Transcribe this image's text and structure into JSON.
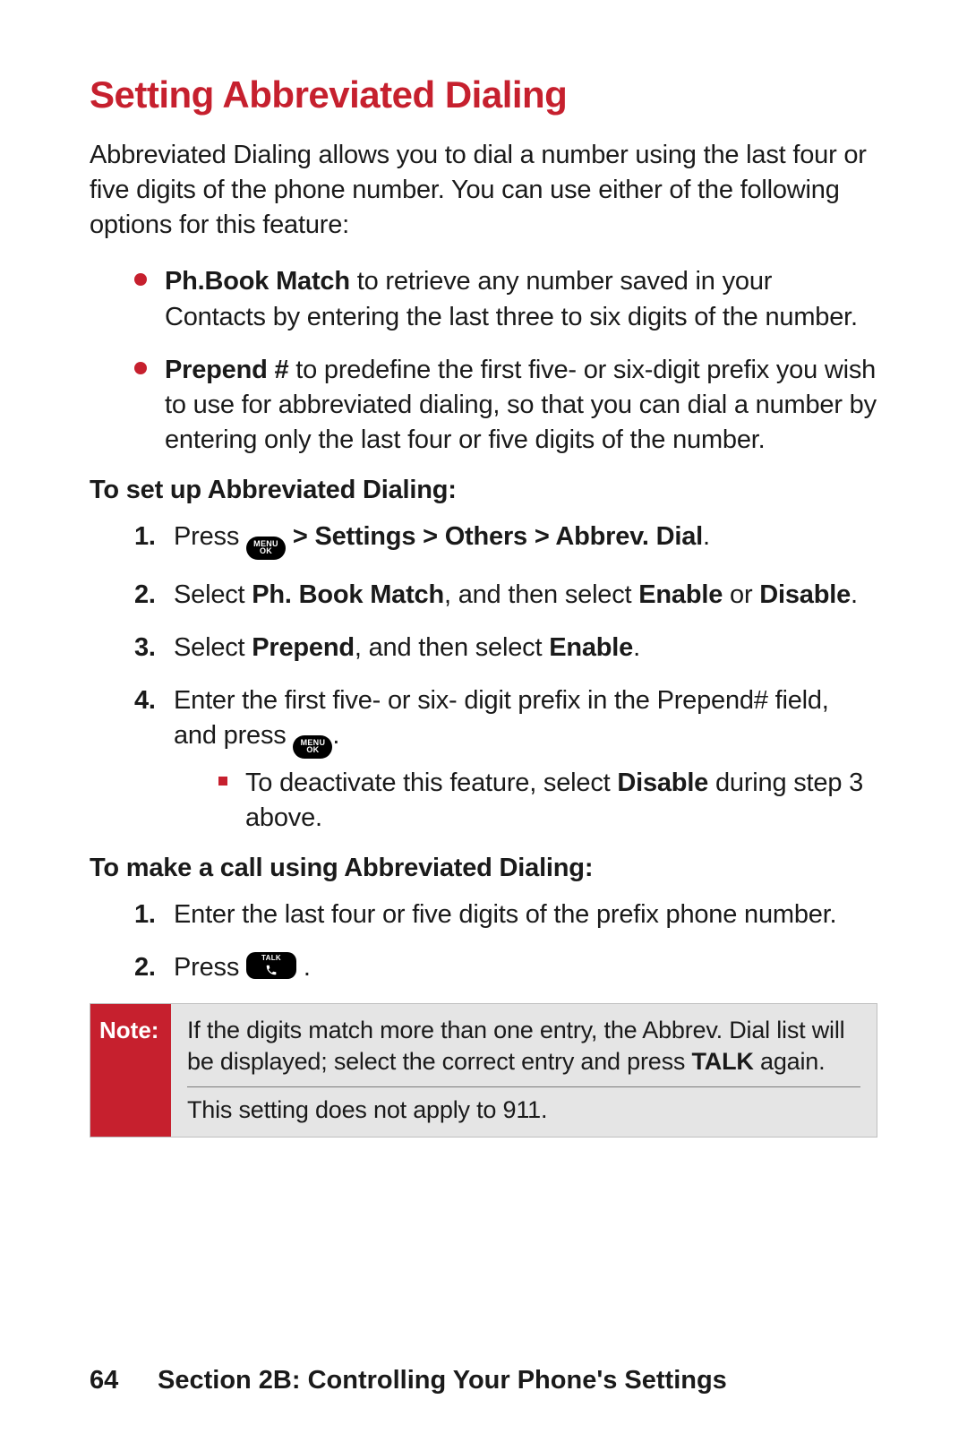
{
  "colors": {
    "brand_red": "#c6202e"
  },
  "heading": "Setting Abbreviated Dialing",
  "intro": "Abbreviated Dialing allows you to dial a number using the last four or five digits of the phone number. You can use either of the following options for this feature:",
  "options": [
    {
      "term": "Ph.Book Match",
      "rest": " to retrieve any number saved in your Contacts by entering the last three to six digits of the number."
    },
    {
      "term": "Prepend #",
      "rest": " to predefine the first five- or six-digit prefix you wish to use for abbreviated dialing, so that you can dial a number by entering only the last four or five digits of the number."
    }
  ],
  "setup": {
    "subheading": "To set up Abbreviated Dialing:",
    "steps": {
      "s1_before": "Press ",
      "s1_path": " > Settings > Others > Abbrev. Dial",
      "s1_end": ".",
      "s2_a": "Select ",
      "s2_b": "Ph. Book Match",
      "s2_c": ", and then select ",
      "s2_d": "Enable",
      "s2_e": " or ",
      "s2_f": "Disable",
      "s2_g": ".",
      "s3_a": "Select ",
      "s3_b": "Prepend",
      "s3_c": ", and then select ",
      "s3_d": "Enable",
      "s3_e": ".",
      "s4_a": "Enter the first five- or six- digit prefix in the Prepend# field, and press ",
      "s4_b": ".",
      "s4_sub_a": "To deactivate this feature, select ",
      "s4_sub_b": "Disable",
      "s4_sub_c": " during step 3 above."
    }
  },
  "call": {
    "subheading": "To make a call using Abbreviated Dialing:",
    "steps": {
      "c1": "Enter the last four or five digits of the prefix phone number.",
      "c2_a": "Press ",
      "c2_b": "."
    }
  },
  "icons": {
    "menu_line1": "MENU",
    "menu_line2": "OK",
    "talk_label": "TALK"
  },
  "note": {
    "label": "Note:",
    "line1_a": "If the digits match more than one entry, the Abbrev. Dial list will be displayed; select the correct entry and press ",
    "line1_b": "TALK",
    "line1_c": " again.",
    "line2": "This setting does not apply to 911."
  },
  "footer": {
    "page_number": "64",
    "section": "Section 2B: Controlling Your Phone's Settings"
  }
}
